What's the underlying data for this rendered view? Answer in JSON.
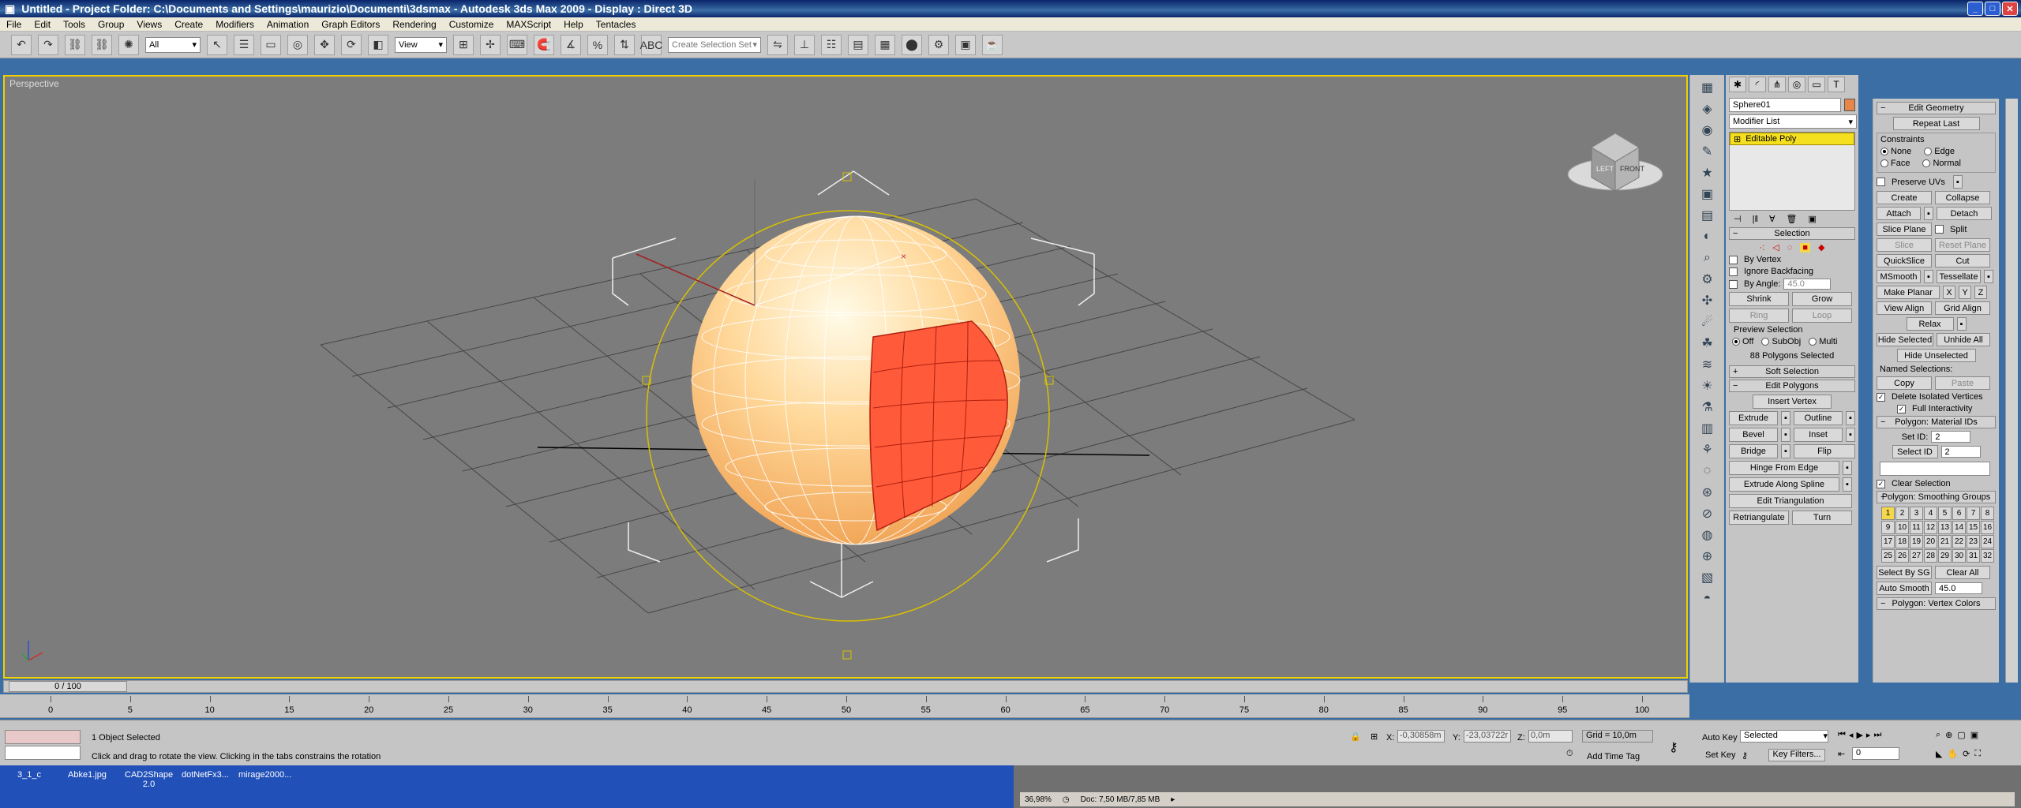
{
  "window": {
    "title": "Untitled     - Project Folder: C:\\Documents and Settings\\maurizio\\Documenti\\3dsmax     - Autodesk 3ds Max  2009     - Display : Direct 3D",
    "title_color": "#0a246a"
  },
  "menu": [
    "File",
    "Edit",
    "Tools",
    "Group",
    "Views",
    "Create",
    "Modifiers",
    "Animation",
    "Graph Editors",
    "Rendering",
    "Customize",
    "MAXScript",
    "Help",
    "Tentacles"
  ],
  "toolbar": {
    "filter_select": "All",
    "ref_coord_select": "View",
    "named_selection_placeholder": "Create Selection Set"
  },
  "viewport": {
    "label": "Perspective",
    "active_border_color": "#f0d000",
    "sphere_color": "#ffc070",
    "selected_faces_color": "#ff5a3a",
    "viewcube": {
      "left": "LEFT",
      "front": "FRONT"
    }
  },
  "command_panel": {
    "object_name": "Sphere01",
    "object_color": "#e8864a",
    "modifier_list": "Modifier List",
    "stack_item": "Editable Poly",
    "selection": {
      "title": "Selection",
      "by_vertex": "By Vertex",
      "ignore_backfacing": "Ignore Backfacing",
      "by_angle": "By Angle:",
      "by_angle_value": "45.0",
      "shrink": "Shrink",
      "grow": "Grow",
      "ring": "Ring",
      "loop": "Loop",
      "preview_selection": "Preview Selection",
      "preview_off": "Off",
      "preview_subobj": "SubObj",
      "preview_multi": "Multi",
      "status": "88 Polygons Selected"
    },
    "soft_selection": "Soft Selection",
    "edit_polygons": {
      "title": "Edit Polygons",
      "insert_vertex": "Insert Vertex",
      "extrude": "Extrude",
      "outline": "Outline",
      "bevel": "Bevel",
      "inset": "Inset",
      "bridge": "Bridge",
      "flip": "Flip",
      "hinge_from_edge": "Hinge From Edge",
      "extrude_along_spline": "Extrude Along Spline",
      "edit_triangulation": "Edit Triangulation",
      "retriangulate": "Retriangulate",
      "turn": "Turn"
    }
  },
  "edit_geometry": {
    "title": "Edit Geometry",
    "repeat_last": "Repeat Last",
    "constraints": "Constraints",
    "c_none": "None",
    "c_edge": "Edge",
    "c_face": "Face",
    "c_normal": "Normal",
    "preserve_uvs": "Preserve UVs",
    "create": "Create",
    "collapse": "Collapse",
    "attach": "Attach",
    "detach": "Detach",
    "slice_plane": "Slice Plane",
    "split": "Split",
    "slice": "Slice",
    "reset_plane": "Reset Plane",
    "quickslice": "QuickSlice",
    "cut": "Cut",
    "msmooth": "MSmooth",
    "tessellate": "Tessellate",
    "make_planar": "Make Planar",
    "x": "X",
    "y": "Y",
    "z": "Z",
    "view_align": "View Align",
    "grid_align": "Grid Align",
    "relax": "Relax",
    "hide_selected": "Hide Selected",
    "unhide_all": "Unhide All",
    "hide_unselected": "Hide Unselected",
    "named_selections": "Named Selections:",
    "copy": "Copy",
    "paste": "Paste",
    "delete_isolated": "Delete Isolated Vertices",
    "full_interactivity": "Full Interactivity",
    "material_ids": "Polygon: Material IDs",
    "set_id": "Set ID:",
    "set_id_value": "2",
    "select_id": "Select ID",
    "select_id_value": "2",
    "clear_selection": "Clear Selection",
    "smoothing_groups": "Polygon: Smoothing Groups",
    "sg_numbers": [
      "1",
      "2",
      "3",
      "4",
      "5",
      "6",
      "7",
      "8",
      "9",
      "10",
      "11",
      "12",
      "13",
      "14",
      "15",
      "16",
      "17",
      "18",
      "19",
      "20",
      "21",
      "22",
      "23",
      "24",
      "25",
      "26",
      "27",
      "28",
      "29",
      "30",
      "31",
      "32"
    ],
    "select_by_sg": "Select By SG",
    "clear_all": "Clear All",
    "auto_smooth": "Auto Smooth",
    "auto_smooth_value": "45.0",
    "vertex_colors": "Polygon: Vertex Colors"
  },
  "timeline": {
    "frame_label": "0 / 100",
    "ticks": [
      "0",
      "5",
      "10",
      "15",
      "20",
      "25",
      "30",
      "35",
      "40",
      "45",
      "50",
      "55",
      "60",
      "65",
      "70",
      "75",
      "80",
      "85",
      "90",
      "95",
      "100"
    ]
  },
  "status": {
    "objects_selected": "1 Object Selected",
    "prompt": "Click and drag to rotate the view.  Clicking in the tabs constrains the rotation",
    "x_label": "X:",
    "x_value": "-0,30858m",
    "y_label": "Y:",
    "y_value": "-23,03722r",
    "z_label": "Z:",
    "z_value": "0,0m",
    "grid": "Grid = 10,0m",
    "add_time_tag": "Add Time Tag",
    "auto_key": "Auto Key",
    "set_key": "Set Key",
    "key_mode": "Selected",
    "key_filters": "Key Filters...",
    "frame_value": "0"
  },
  "taskbar": {
    "items": [
      "3_1_c",
      "Abke1.jpg",
      "CAD2Shape\n2.0",
      "dotNetFx3...",
      "mirage2000..."
    ],
    "viewer_zoom": "36,98%",
    "viewer_doc": "Doc: 7,50 MB/7,85 MB"
  }
}
